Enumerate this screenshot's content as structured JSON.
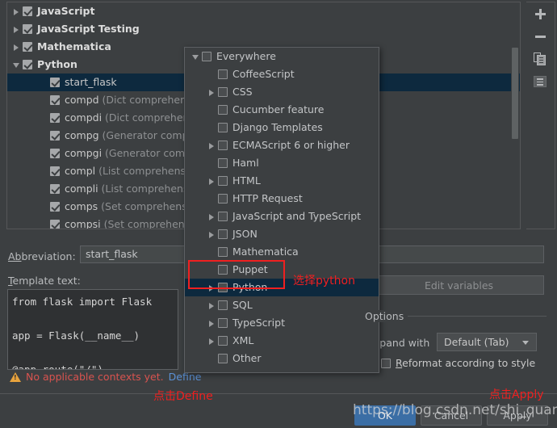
{
  "tree": {
    "rows": [
      {
        "indent": 0,
        "arrow": "closed",
        "checked": true,
        "bold": true,
        "label": "JavaScript",
        "detail": ""
      },
      {
        "indent": 0,
        "arrow": "closed",
        "checked": true,
        "bold": true,
        "label": "JavaScript Testing",
        "detail": ""
      },
      {
        "indent": 0,
        "arrow": "closed",
        "checked": true,
        "bold": true,
        "label": "Mathematica",
        "detail": ""
      },
      {
        "indent": 0,
        "arrow": "open",
        "checked": true,
        "bold": true,
        "label": "Python",
        "detail": ""
      },
      {
        "indent": 1,
        "arrow": "none",
        "checked": true,
        "bold": false,
        "label": "start_flask",
        "detail": "",
        "selected": true
      },
      {
        "indent": 1,
        "arrow": "none",
        "checked": true,
        "bold": false,
        "label": "compd",
        "detail": "(Dict comprehension)"
      },
      {
        "indent": 1,
        "arrow": "none",
        "checked": true,
        "bold": false,
        "label": "compdi",
        "detail": "(Dict comprehension"
      },
      {
        "indent": 1,
        "arrow": "none",
        "checked": true,
        "bold": false,
        "label": "compg",
        "detail": "(Generator comprehe"
      },
      {
        "indent": 1,
        "arrow": "none",
        "checked": true,
        "bold": false,
        "label": "compgi",
        "detail": "(Generator compreh"
      },
      {
        "indent": 1,
        "arrow": "none",
        "checked": true,
        "bold": false,
        "label": "compl",
        "detail": "(List comprehension)"
      },
      {
        "indent": 1,
        "arrow": "none",
        "checked": true,
        "bold": false,
        "label": "compli",
        "detail": "(List comprehension"
      },
      {
        "indent": 1,
        "arrow": "none",
        "checked": true,
        "bold": false,
        "label": "comps",
        "detail": "(Set comprehension)"
      },
      {
        "indent": 1,
        "arrow": "none",
        "checked": true,
        "bold": false,
        "label": "compsi",
        "detail": "(Set comprehension"
      }
    ]
  },
  "toolbar": {
    "add_icon": "plus-icon",
    "remove_icon": "minus-icon",
    "duplicate_icon": "copy-icon",
    "list_icon": "list-icon"
  },
  "form": {
    "abbreviation_label": "Abbreviation:",
    "abbreviation_value": "start_flask",
    "template_text_label": "Template text:",
    "template_text_value": "from flask import Flask\n\napp = Flask(__name__)\n\n@app.route(\"/\")",
    "description_value": "",
    "edit_variables_label": "Edit variables",
    "options_label": "Options",
    "expand_with_label": "Expand with",
    "expand_with_value": "Default (Tab)",
    "reformat_label": "Reformat according to style",
    "reformat_checked": false
  },
  "warning": {
    "icon": "warning-triangle-icon",
    "text": "No applicable contexts yet.",
    "link": "Define"
  },
  "buttons": {
    "ok": "OK",
    "cancel": "Cancel",
    "apply": "Apply"
  },
  "popup": {
    "rows": [
      {
        "indent": 0,
        "arrow": "open",
        "label": "Everywhere"
      },
      {
        "indent": 1,
        "arrow": "none",
        "label": "CoffeeScript"
      },
      {
        "indent": 1,
        "arrow": "closed",
        "label": "CSS"
      },
      {
        "indent": 1,
        "arrow": "none",
        "label": "Cucumber feature"
      },
      {
        "indent": 1,
        "arrow": "none",
        "label": "Django Templates"
      },
      {
        "indent": 1,
        "arrow": "closed",
        "label": "ECMAScript 6 or higher"
      },
      {
        "indent": 1,
        "arrow": "none",
        "label": "Haml"
      },
      {
        "indent": 1,
        "arrow": "closed",
        "label": "HTML"
      },
      {
        "indent": 1,
        "arrow": "none",
        "label": "HTTP Request"
      },
      {
        "indent": 1,
        "arrow": "closed",
        "label": "JavaScript and TypeScript"
      },
      {
        "indent": 1,
        "arrow": "closed",
        "label": "JSON"
      },
      {
        "indent": 1,
        "arrow": "none",
        "label": "Mathematica"
      },
      {
        "indent": 1,
        "arrow": "none",
        "label": "Puppet"
      },
      {
        "indent": 1,
        "arrow": "closed",
        "label": "Python",
        "selected": true
      },
      {
        "indent": 1,
        "arrow": "closed",
        "label": "SQL"
      },
      {
        "indent": 1,
        "arrow": "closed",
        "label": "TypeScript"
      },
      {
        "indent": 1,
        "arrow": "closed",
        "label": "XML"
      },
      {
        "indent": 1,
        "arrow": "none",
        "label": "Other"
      }
    ]
  },
  "annotations": {
    "select_python": "选择python",
    "click_define": "点击Define",
    "click_apply": "点击Apply",
    "watermark": "https://blog.csdn.net/shi_quandong"
  },
  "colors": {
    "background": "#3c3f41",
    "selection": "#0d293e",
    "annotation_red": "#ef2020",
    "primary_button": "#3b6ea5",
    "warning_red": "#d9534f",
    "link_blue": "#5b91d6"
  }
}
